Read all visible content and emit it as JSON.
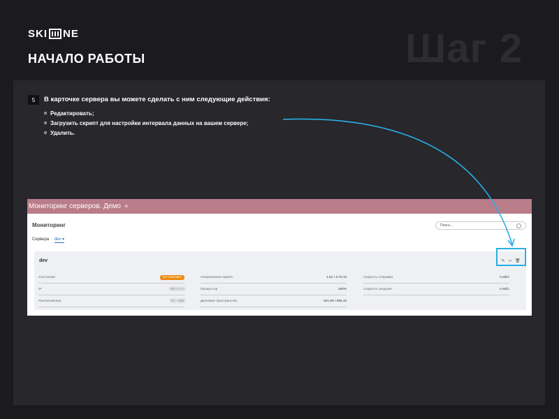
{
  "brand": {
    "logo_left": "SKI",
    "logo_right": "NE"
  },
  "header": {
    "title": "НАЧАЛО РАБОТЫ",
    "step": "Шаг 2"
  },
  "instruction": {
    "number": "5",
    "intro": "В карточке сервера вы можете сделать с ним следующие действия:",
    "items": [
      "Редактировать;",
      "Загрузить скрипт для настройки интервала данных на вашем сервере;",
      "Удалить."
    ]
  },
  "screenshot": {
    "header_title": "Мониторинг серверов. Демо",
    "section_title": "Мониторинг",
    "search_placeholder": "Поиск...",
    "tabs": {
      "servers": "Сервера",
      "dev": "dev"
    },
    "card": {
      "name": "dev",
      "columns": [
        [
          {
            "label": "Состояние",
            "value": "Не отвечает"
          },
          {
            "label": "IP",
            "value": "185.12.13"
          },
          {
            "label": "Расположение",
            "value": "RU / Msk"
          }
        ],
        [
          {
            "label": "Оперативная память",
            "value": "1.51 / 3.70 гБ"
          },
          {
            "label": "Процессор",
            "value": "100%"
          },
          {
            "label": "Дисковое пространство",
            "value": "521.99 / 695 гБ"
          }
        ],
        [
          {
            "label": "Скорость отправки",
            "value": "0 мб/с"
          },
          {
            "label": "Скорость загрузки",
            "value": "0 мб/с"
          }
        ]
      ]
    }
  },
  "colors": {
    "accent": "#29aee5",
    "header_bg": "#b97c89",
    "status": "#f0890e"
  }
}
